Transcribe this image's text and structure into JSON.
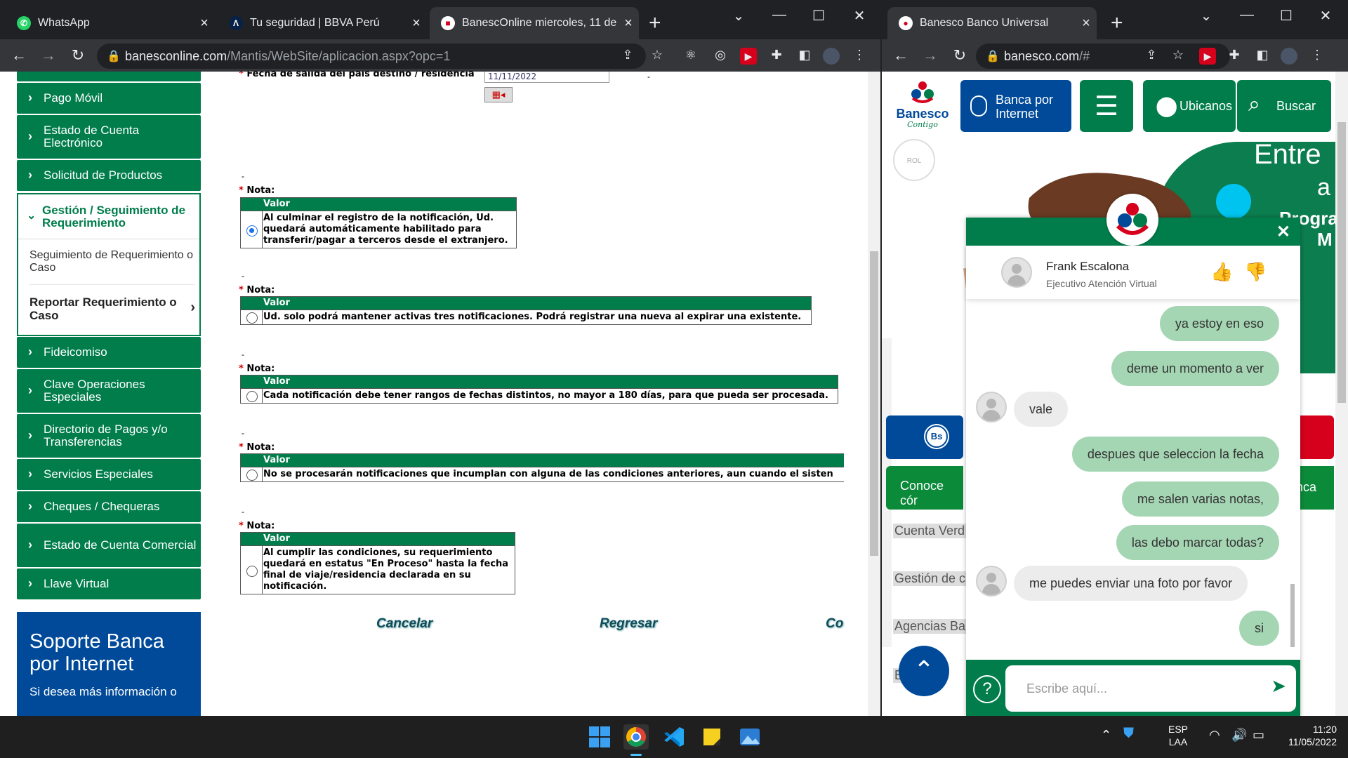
{
  "left_window": {
    "tabs": [
      {
        "title": "WhatsApp",
        "icon": "whatsapp-icon"
      },
      {
        "title": "Tu seguridad | BBVA Perú",
        "icon": "bbva-icon"
      },
      {
        "title": "BanescOnline miercoles, 11 de m",
        "icon": "banesco-icon"
      }
    ],
    "url_host": "banesconline.com",
    "url_path": "/Mantis/WebSite/aplicacion.aspx?opc=1",
    "menu": [
      "Pago Móvil",
      "Estado de Cuenta Electrónico",
      "Solicitud de Productos",
      "Fideicomiso",
      "Clave Operaciones Especiales",
      "Directorio de Pagos y/o Transferencias",
      "Servicios Especiales",
      "Cheques / Chequeras",
      "Estado de Cuenta Comercial",
      "Llave Virtual"
    ],
    "gestion": {
      "title": "Gestión / Seguimiento de Requerimiento",
      "sub1": "Seguimiento de Requerimiento o Caso",
      "sub2": "Reportar Requerimiento o Caso"
    },
    "support": {
      "title": "Soporte Banca por Internet",
      "text": "Si desea más información o"
    },
    "form": {
      "date_label": "Fecha de salida del país destino / residencia",
      "date_value": "11/11/2022",
      "nota_label": "Nota:",
      "valor_header": "Valor",
      "notes": [
        {
          "text": "Al culminar el registro de la notificación, Ud. quedará automáticamente habilitado para transferir/pagar a terceros desde el extranjero.",
          "checked": true
        },
        {
          "text": "Ud. solo podrá mantener activas tres notificaciones. Podrá registrar una nueva al expirar una existente.",
          "checked": false
        },
        {
          "text": "Cada notificación debe tener rangos de fechas distintos, no mayor a 180 días, para que pueda ser procesada.",
          "checked": false
        },
        {
          "text": "No se procesarán notificaciones que incumplan con alguna de las condiciones anteriores, aun cuando el sisten",
          "checked": false
        },
        {
          "text": "Al cumplir las condiciones, su requerimiento quedará en estatus \"En Proceso\" hasta la fecha final de viaje/residencia declarada en su notificación.",
          "checked": false
        }
      ],
      "actions": [
        "Cancelar",
        "Regresar",
        "Co"
      ]
    }
  },
  "right_window": {
    "tab": "Banesco Banco Universal",
    "url_host": "banesco.com",
    "url_path": "/#",
    "nav": {
      "banca": "Banca por Internet",
      "ubicanos": "Ubicanos",
      "buscar": "Buscar",
      "logo": "Banesco",
      "logo_sub": "Contigo"
    },
    "hero": {
      "line1": "Entre",
      "line2": "a",
      "line3": "Progra",
      "line4": "M"
    },
    "links": [
      "Cuenta Verd",
      "Gestión de c",
      "Agencias Ba",
      "E           esc"
    ],
    "buttons": {
      "conoce": "Conoce cór",
      "nca": "nca",
      "bs": "Bs"
    },
    "chat": {
      "agent_name": "Frank Escalona",
      "agent_role": "Ejecutivo Atención Virtual",
      "messages": [
        {
          "from": "me",
          "text": "ya estoy en eso"
        },
        {
          "from": "me",
          "text": "deme un momento a ver"
        },
        {
          "from": "them",
          "text": "vale"
        },
        {
          "from": "me",
          "text": "despues que seleccion la fecha"
        },
        {
          "from": "me",
          "text": "me salen varias notas,"
        },
        {
          "from": "me",
          "text": "las debo marcar todas?"
        },
        {
          "from": "them",
          "text": "me puedes enviar una foto por favor"
        },
        {
          "from": "me",
          "text": "si"
        }
      ],
      "input_placeholder": "Escribe aquí..."
    }
  },
  "taskbar": {
    "lang": "ESP",
    "lang2": "LAA",
    "time": "11:20",
    "date": "11/05/2022"
  },
  "colors": {
    "banesco_green": "#007d4b",
    "banesco_blue": "#004a99",
    "bubble_me": "#a5d6b4"
  }
}
